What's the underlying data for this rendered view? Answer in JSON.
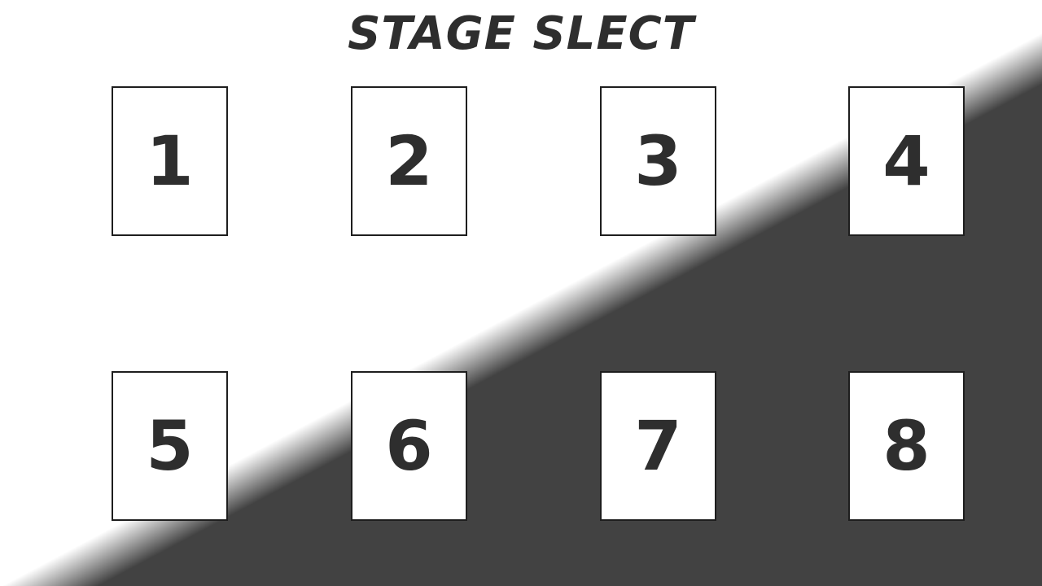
{
  "screen": {
    "title": "STAGE SLECT"
  },
  "stages": [
    {
      "label": "1"
    },
    {
      "label": "2"
    },
    {
      "label": "3"
    },
    {
      "label": "4"
    },
    {
      "label": "5"
    },
    {
      "label": "6"
    },
    {
      "label": "7"
    },
    {
      "label": "8"
    }
  ],
  "colors": {
    "light_background": "#ffffff",
    "dark_background": "#424242",
    "text": "#2e2e2e",
    "tile_border": "#1e1e1e"
  }
}
